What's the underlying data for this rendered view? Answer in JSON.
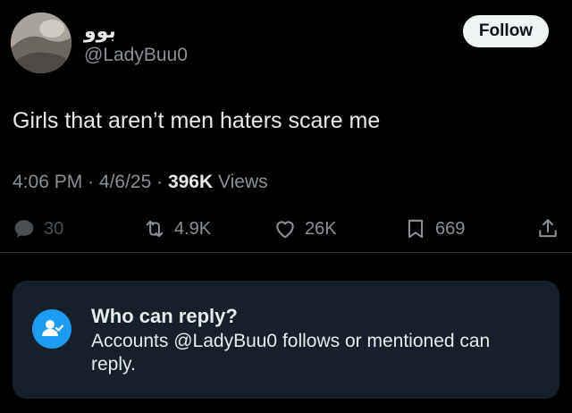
{
  "author": {
    "display_name": "بوو",
    "handle": "@LadyBuu0"
  },
  "follow_label": "Follow",
  "tweet": {
    "text": "Girls that aren’t men haters scare me"
  },
  "meta": {
    "time": "4:06 PM",
    "date": "4/6/25",
    "views_count": "396K",
    "views_label": "Views"
  },
  "actions": {
    "replies": "30",
    "reposts": "4.9K",
    "likes": "26K",
    "bookmarks": "669"
  },
  "reply_settings": {
    "title": "Who can reply?",
    "description": "Accounts @LadyBuu0 follows or mentioned can reply."
  },
  "colors": {
    "background": "#000000",
    "card": "#16202a",
    "accent": "#1d9bf0",
    "muted_text": "#8b9096"
  },
  "icons": [
    "reply-icon",
    "repost-icon",
    "heart-icon",
    "bookmark-icon",
    "share-icon",
    "people-icon"
  ]
}
